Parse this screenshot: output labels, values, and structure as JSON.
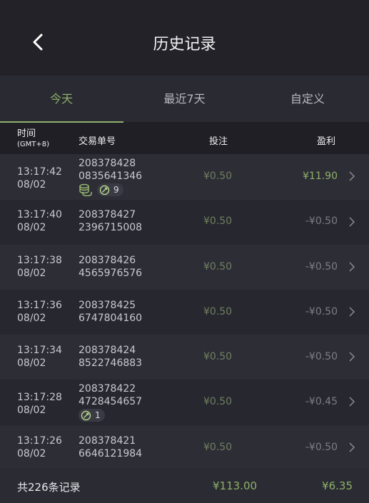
{
  "header": {
    "title": "历史记录",
    "back_icon": "chevron-left-icon"
  },
  "tabs": [
    {
      "label": "今天",
      "active": true
    },
    {
      "label": "最近7天",
      "active": false
    },
    {
      "label": "自定义",
      "active": false
    }
  ],
  "columns": {
    "time": "时间",
    "timezone": "(GMT+8)",
    "order": "交易单号",
    "bet": "投注",
    "profit": "盈利"
  },
  "rows": [
    {
      "time": "13:17:42",
      "date": "08/02",
      "order_a": "208378428",
      "order_b": "0835641346",
      "bet": "¥0.50",
      "profit": "¥11.90",
      "win": true,
      "coins_icon": true,
      "free_spin_count": "9"
    },
    {
      "time": "13:17:40",
      "date": "08/02",
      "order_a": "208378427",
      "order_b": "2396715008",
      "bet": "¥0.50",
      "profit": "-¥0.50",
      "win": false
    },
    {
      "time": "13:17:38",
      "date": "08/02",
      "order_a": "208378426",
      "order_b": "4565976576",
      "bet": "¥0.50",
      "profit": "-¥0.50",
      "win": false
    },
    {
      "time": "13:17:36",
      "date": "08/02",
      "order_a": "208378425",
      "order_b": "6747804160",
      "bet": "¥0.50",
      "profit": "-¥0.50",
      "win": false
    },
    {
      "time": "13:17:34",
      "date": "08/02",
      "order_a": "208378424",
      "order_b": "8522746883",
      "bet": "¥0.50",
      "profit": "-¥0.50",
      "win": false
    },
    {
      "time": "13:17:28",
      "date": "08/02",
      "order_a": "208378422",
      "order_b": "4728454657",
      "bet": "¥0.50",
      "profit": "-¥0.45",
      "win": false,
      "free_spin_count": "1"
    },
    {
      "time": "13:17:26",
      "date": "08/02",
      "order_a": "208378421",
      "order_b": "6646121984",
      "bet": "¥0.50",
      "profit": "-¥0.50",
      "win": false
    }
  ],
  "footer": {
    "total_label": "共226条记录",
    "total_bet": "¥113.00",
    "total_profit": "¥6.35"
  },
  "colors": {
    "accent": "#8fb169",
    "background": "#232329"
  }
}
